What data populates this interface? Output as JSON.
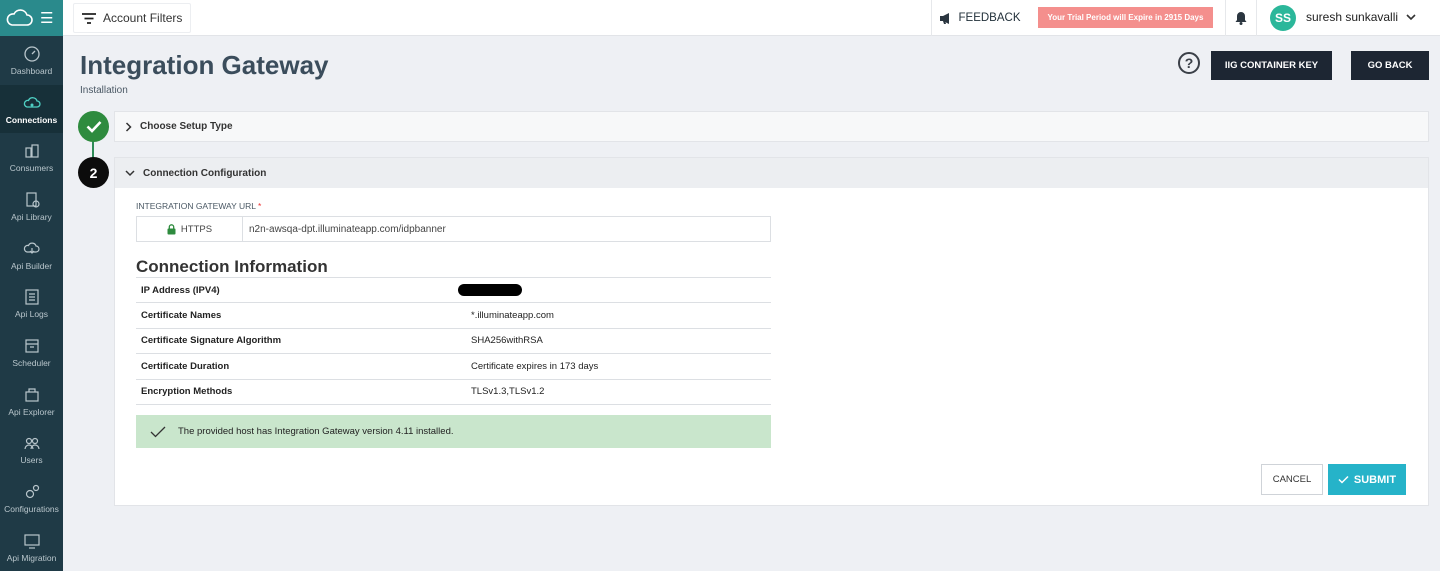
{
  "sidebar": {
    "items": [
      {
        "label": "Dashboard",
        "icon": "dashboard-icon"
      },
      {
        "label": "Connections",
        "icon": "connections-icon",
        "active": true
      },
      {
        "label": "Consumers",
        "icon": "consumers-icon"
      },
      {
        "label": "Api Library",
        "icon": "api-library-icon"
      },
      {
        "label": "Api Builder",
        "icon": "api-builder-icon"
      },
      {
        "label": "Api Logs",
        "icon": "api-logs-icon"
      },
      {
        "label": "Scheduler",
        "icon": "scheduler-icon"
      },
      {
        "label": "Api Explorer",
        "icon": "api-explorer-icon"
      },
      {
        "label": "Users",
        "icon": "users-icon"
      },
      {
        "label": "Configurations",
        "icon": "configurations-icon"
      },
      {
        "label": "Api Migration",
        "icon": "api-migration-icon"
      }
    ]
  },
  "topbar": {
    "account_filters": "Account Filters",
    "feedback": "FEEDBACK",
    "trial": "Your Trial Period will Expire in 2915 Days",
    "avatar_initials": "SS",
    "username": "suresh sunkavalli"
  },
  "header": {
    "title": "Integration Gateway",
    "subtitle": "Installation",
    "help_symbol": "?",
    "key_button": "IIG CONTAINER KEY",
    "back_button": "GO BACK"
  },
  "steps": {
    "step1_title": "Choose Setup Type",
    "step2_number": "2",
    "step2_title": "Connection Configuration"
  },
  "form": {
    "url_label": "INTEGRATION GATEWAY URL",
    "required_mark": "*",
    "protocol": "HTTPS",
    "url_value": "n2n-awsqa-dpt.illuminateapp.com/idpbanner"
  },
  "connection_info": {
    "title": "Connection Information",
    "rows": [
      {
        "label": "IP Address (IPV4)",
        "value": ""
      },
      {
        "label": "Certificate Names",
        "value": "*.illuminateapp.com"
      },
      {
        "label": "Certificate Signature Algorithm",
        "value": "SHA256withRSA"
      },
      {
        "label": "Certificate Duration",
        "value": "Certificate expires in 173 days"
      },
      {
        "label": "Encryption Methods",
        "value": "TLSv1.3,TLSv1.2"
      }
    ]
  },
  "status": {
    "message": "The provided host has Integration Gateway version 4.11 installed."
  },
  "actions": {
    "cancel": "CANCEL",
    "submit": "SUBMIT"
  },
  "colors": {
    "sidebar_bg": "#1f3a46",
    "accent": "#26b3c9",
    "success_bg": "#c9e6cc",
    "step_done": "#2e8b3e",
    "trial_bg": "#f48f8d"
  }
}
